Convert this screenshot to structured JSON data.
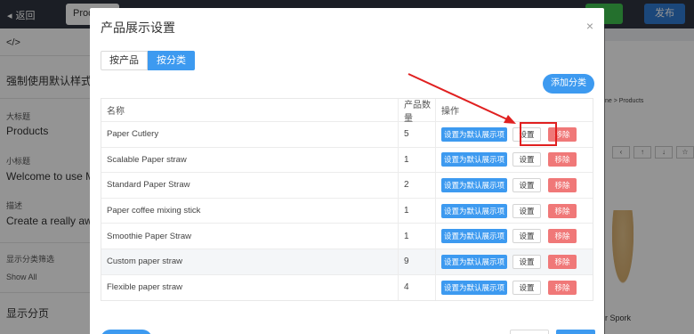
{
  "topbar": {
    "back_label": "返回",
    "tab_label": "Prod",
    "publish_label": "发布"
  },
  "sidebar": {
    "code_icon": "</>",
    "force_default": "强制使用默认样式",
    "title_label": "大标题",
    "title_value": "Products",
    "subtitle_label": "小标题",
    "subtitle_value": "Welcome to use Match",
    "desc_label": "描述",
    "desc_value": "Create a really awesom",
    "filter_label": "显示分类筛选",
    "filter_value": "Show All",
    "paging_label": "显示分页"
  },
  "canvas": {
    "breadcrumb": "ne > Products",
    "nav_icons": [
      "chevron-left-icon",
      "arrow-up-icon",
      "arrow-down-icon",
      "star-icon"
    ],
    "product_label": "r Spork"
  },
  "modal": {
    "title": "产品展示设置",
    "close_icon": "×",
    "tabs": [
      {
        "label": "按产品",
        "active": false
      },
      {
        "label": "按分类",
        "active": true
      }
    ],
    "add_category_label": "添加分类",
    "table": {
      "headers": {
        "name": "名称",
        "qty": "产品数量",
        "ops": "操作"
      },
      "set_default_label": "设置为默认展示项",
      "settings_label": "设置",
      "remove_label": "移除",
      "rows": [
        {
          "name": "Paper Cutlery",
          "qty": "5"
        },
        {
          "name": "Scalable Paper straw",
          "qty": "1"
        },
        {
          "name": "Standard Paper Straw",
          "qty": "2"
        },
        {
          "name": "Paper coffee mixing stick",
          "qty": "1"
        },
        {
          "name": "Smoothie Paper Straw",
          "qty": "1"
        },
        {
          "name": "Custom paper straw",
          "qty": "9"
        },
        {
          "name": "Flexible paper straw",
          "qty": "4"
        }
      ]
    }
  },
  "colors": {
    "primary": "#3d9af0",
    "danger": "#f07878",
    "annotation": "#e02020"
  }
}
